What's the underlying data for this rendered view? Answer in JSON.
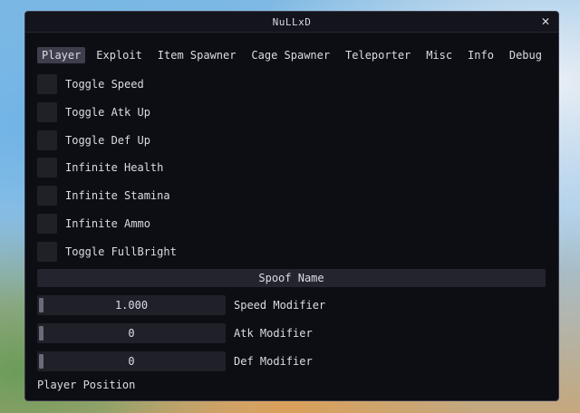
{
  "window": {
    "title": "NuLLxD",
    "close_glyph": "✕"
  },
  "tabs": [
    {
      "label": "Player",
      "active": true
    },
    {
      "label": "Exploit"
    },
    {
      "label": "Item Spawner"
    },
    {
      "label": "Cage Spawner"
    },
    {
      "label": "Teleporter"
    },
    {
      "label": "Misc"
    },
    {
      "label": "Info"
    },
    {
      "label": "Debug"
    }
  ],
  "toggles": [
    {
      "label": "Toggle Speed",
      "checked": false
    },
    {
      "label": "Toggle Atk Up",
      "checked": false
    },
    {
      "label": "Toggle Def Up",
      "checked": false
    },
    {
      "label": "Infinite Health",
      "checked": false
    },
    {
      "label": "Infinite Stamina",
      "checked": false
    },
    {
      "label": "Infinite Ammo",
      "checked": false
    },
    {
      "label": "Toggle FullBright",
      "checked": false
    }
  ],
  "spoof_button": {
    "label": "Spoof Name"
  },
  "sliders": [
    {
      "value": "1.000",
      "label": "Speed Modifier"
    },
    {
      "value": "0",
      "label": "Atk Modifier"
    },
    {
      "value": "0",
      "label": "Def Modifier"
    }
  ],
  "player_position_label": "Player Position",
  "colors": {
    "window_bg": "#0d0d14",
    "active_tab": "#3e3e4c",
    "widget_bg": "#202028",
    "text": "#dcdce4"
  }
}
